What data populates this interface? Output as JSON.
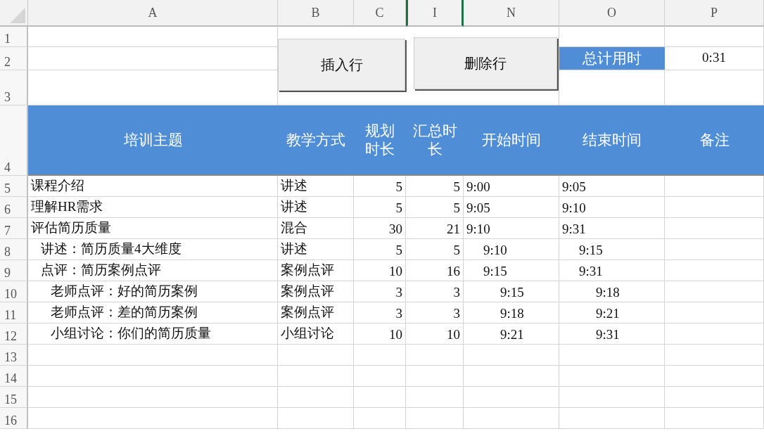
{
  "column_headers": [
    "A",
    "B",
    "C",
    "I",
    "N",
    "O",
    "P"
  ],
  "row_numbers": [
    "1",
    "2",
    "3",
    "4",
    "5",
    "6",
    "7",
    "8",
    "9",
    "10",
    "11",
    "12",
    "13",
    "14",
    "15",
    "16"
  ],
  "buttons": [
    {
      "label": "插入行"
    },
    {
      "label": "删除行"
    }
  ],
  "total": {
    "label": "总计用时",
    "value": "0:31"
  },
  "table": {
    "columns": [
      "培训主题",
      "教学方式",
      "规划时长",
      "汇总时长",
      "开始时间",
      "结束时间",
      "备注"
    ],
    "rows": [
      {
        "topic": "课程介绍",
        "method": "讲述",
        "planned": "5",
        "total": "5",
        "start": "9:00",
        "end": "9:05"
      },
      {
        "topic": "理解HR需求",
        "method": "讲述",
        "planned": "5",
        "total": "5",
        "start": "9:05",
        "end": "9:10"
      },
      {
        "topic": "评估简历质量",
        "method": "混合",
        "planned": "30",
        "total": "21",
        "start": "9:10",
        "end": "9:31",
        "children": [
          {
            "topic": "讲述：简历质量4大维度",
            "method": "讲述",
            "planned": "5",
            "total": "5",
            "start": "9:10",
            "end": "9:15"
          },
          {
            "topic": "点评：简历案例点评",
            "method": "案例点评",
            "planned": "10",
            "total": "16",
            "start": "9:15",
            "end": "9:31",
            "children": [
              {
                "topic": "老师点评：好的简历案例",
                "method": "案例点评",
                "planned": "3",
                "total": "3",
                "start": "9:15",
                "end": "9:18"
              },
              {
                "topic": "老师点评：差的简历案例",
                "method": "案例点评",
                "planned": "3",
                "total": "3",
                "start": "9:18",
                "end": "9:21"
              },
              {
                "topic": "小组讨论：你们的简历质量",
                "method": "小组讨论",
                "planned": "10",
                "total": "10",
                "start": "9:21",
                "end": "9:31"
              }
            ]
          }
        ]
      }
    ]
  }
}
